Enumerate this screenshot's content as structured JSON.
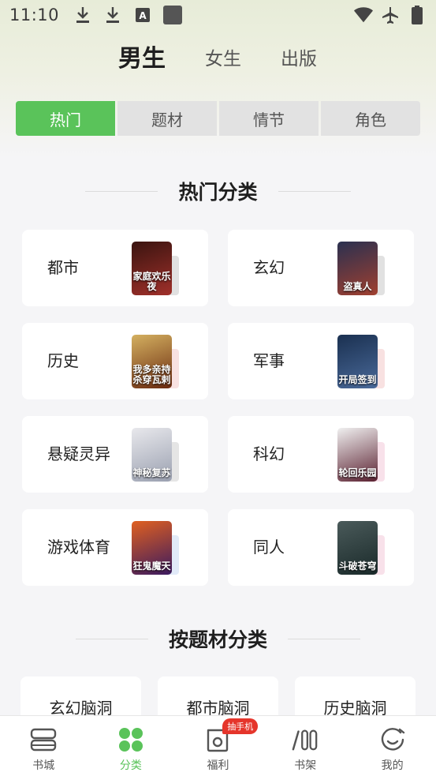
{
  "status_bar": {
    "time": "11:10",
    "left_icons": [
      "download-icon",
      "download-icon",
      "font-app-icon",
      "app-square-icon"
    ],
    "right_icons": [
      "wifi-icon",
      "airplane-icon",
      "battery-icon"
    ]
  },
  "gender_tabs": [
    {
      "label": "男生",
      "active": true
    },
    {
      "label": "女生",
      "active": false
    },
    {
      "label": "出版",
      "active": false
    }
  ],
  "segments": [
    {
      "label": "热门",
      "active": true
    },
    {
      "label": "题材",
      "active": false
    },
    {
      "label": "情节",
      "active": false
    },
    {
      "label": "角色",
      "active": false
    }
  ],
  "hot_section": {
    "title": "热门分类",
    "categories": [
      {
        "name": "都市",
        "cover_text": "家庭欢乐夜",
        "cover_colors": [
          "#3a1410",
          "#a0302a"
        ],
        "back_color": "#c8c8c8"
      },
      {
        "name": "玄幻",
        "cover_text": "盗真人",
        "cover_colors": [
          "#2a3050",
          "#a04030"
        ],
        "back_color": "#c8c8c8"
      },
      {
        "name": "历史",
        "cover_text": "我多亲持杀穿瓦剌",
        "cover_colors": [
          "#d4b060",
          "#6a2a10"
        ],
        "back_color": "#f2c8c8"
      },
      {
        "name": "军事",
        "cover_text": "开局签到",
        "cover_colors": [
          "#1a3050",
          "#4a6a9a"
        ],
        "back_color": "#f2c8c8"
      },
      {
        "name": "悬疑灵异",
        "cover_text": "神秘复苏",
        "cover_colors": [
          "#e8e8ec",
          "#9aa0b0"
        ],
        "back_color": "#d0d0d0"
      },
      {
        "name": "科幻",
        "cover_text": "轮回乐园",
        "cover_colors": [
          "#f0f0f0",
          "#5a2030"
        ],
        "back_color": "#f2c8d8"
      },
      {
        "name": "游戏体育",
        "cover_text": "狂鬼魔天",
        "cover_colors": [
          "#e06020",
          "#3a1a60"
        ],
        "back_color": "#c8d8f2"
      },
      {
        "name": "同人",
        "cover_text": "斗破苍穹",
        "cover_colors": [
          "#4a5a5a",
          "#1a2a2a"
        ],
        "back_color": "#f2c8d8"
      }
    ]
  },
  "theme_section": {
    "title": "按题材分类",
    "items": [
      "玄幻脑洞",
      "都市脑洞",
      "历史脑洞"
    ]
  },
  "bottom_nav": [
    {
      "label": "书城",
      "icon": "bookstore-icon",
      "active": false
    },
    {
      "label": "分类",
      "icon": "category-icon",
      "active": true
    },
    {
      "label": "福利",
      "icon": "welfare-icon",
      "active": false,
      "badge": "抽手机"
    },
    {
      "label": "书架",
      "icon": "bookshelf-icon",
      "active": false
    },
    {
      "label": "我的",
      "icon": "profile-icon",
      "active": false
    }
  ],
  "colors": {
    "accent": "#5ac35a",
    "badge": "#e5352b",
    "background": "#f5f5f7"
  }
}
